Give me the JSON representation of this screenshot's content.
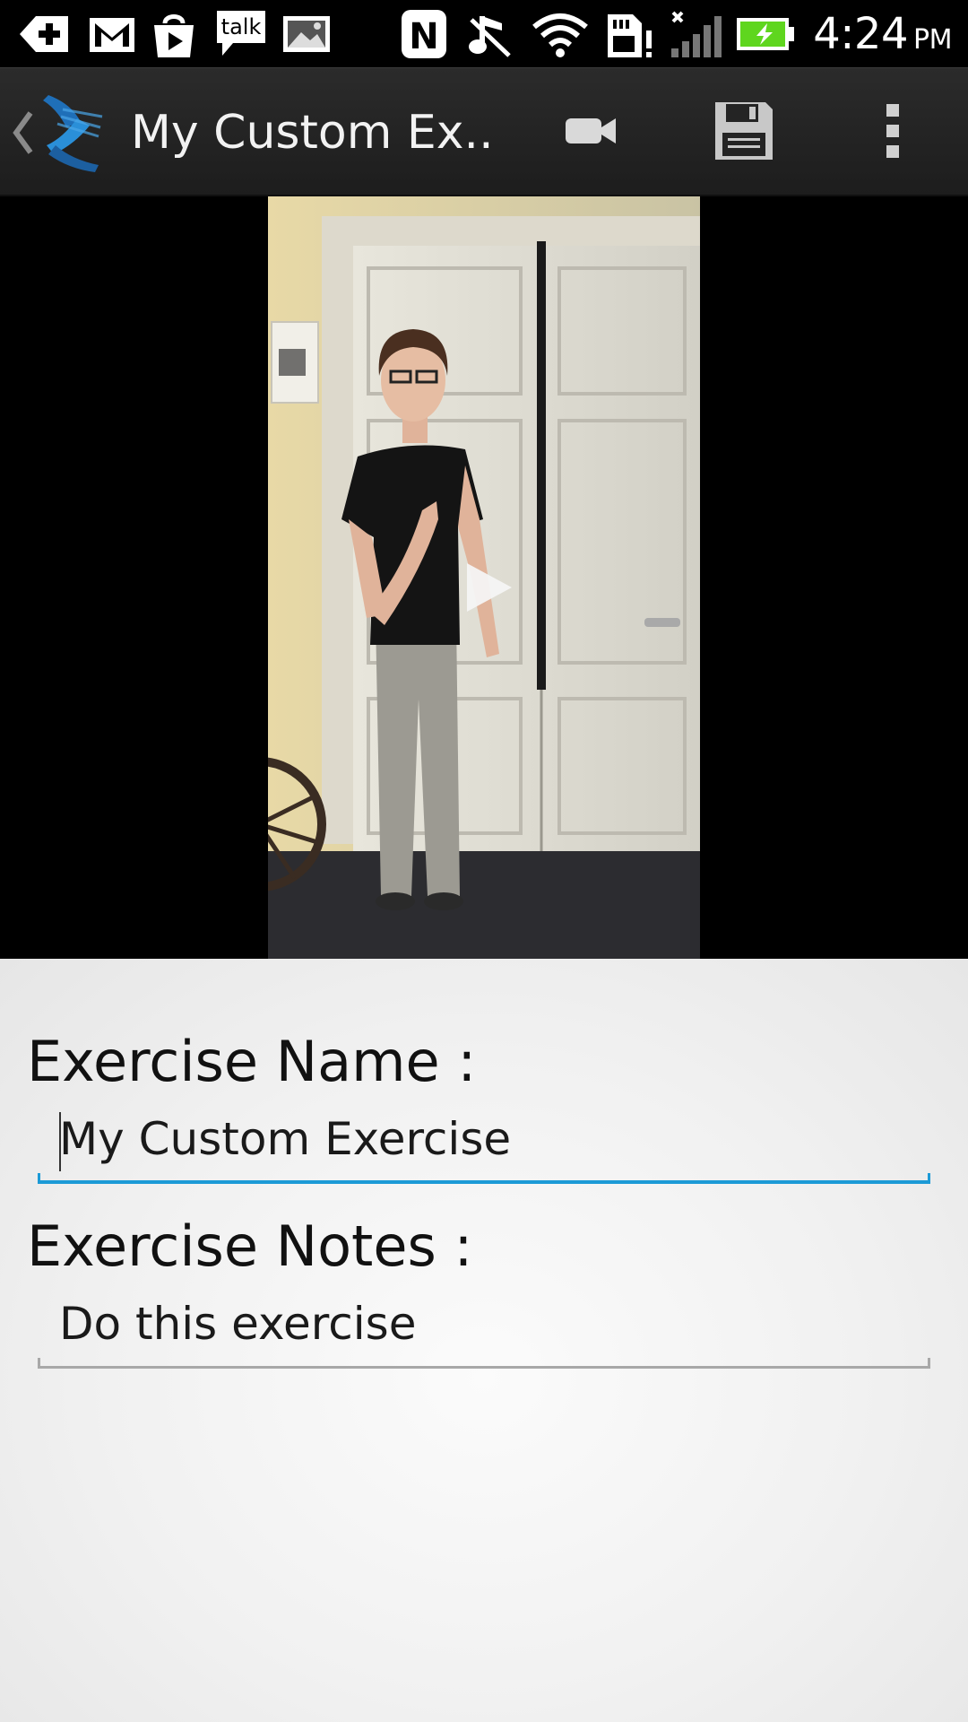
{
  "status_bar": {
    "time": "4:24",
    "ampm": "PM",
    "icons": [
      "add-notification-icon",
      "gmail-icon",
      "play-store-icon",
      "talk-icon",
      "gallery-icon",
      "nfc-icon",
      "music-off-icon",
      "wifi-icon",
      "sd-card-warning-icon",
      "signal-icon",
      "battery-charging-icon"
    ],
    "talk_icon_text": "talk",
    "nfc_icon_text": "N"
  },
  "action_bar": {
    "title": "My Custom Ex...",
    "icons": [
      "back-caret-icon",
      "app-logo-icon",
      "video-camera-icon",
      "save-icon",
      "overflow-menu-icon"
    ]
  },
  "video": {
    "play_icon": "play-icon"
  },
  "form": {
    "exercise_name_label": "Exercise Name :",
    "exercise_name_value": "My Custom Exercise",
    "exercise_notes_label": "Exercise Notes :",
    "exercise_notes_value": "Do this exercise"
  },
  "colors": {
    "focus_accent": "#1c9ad6",
    "battery_green": "#5fd61e",
    "action_bar": "#242424",
    "form_background": "#f2f2f2"
  }
}
